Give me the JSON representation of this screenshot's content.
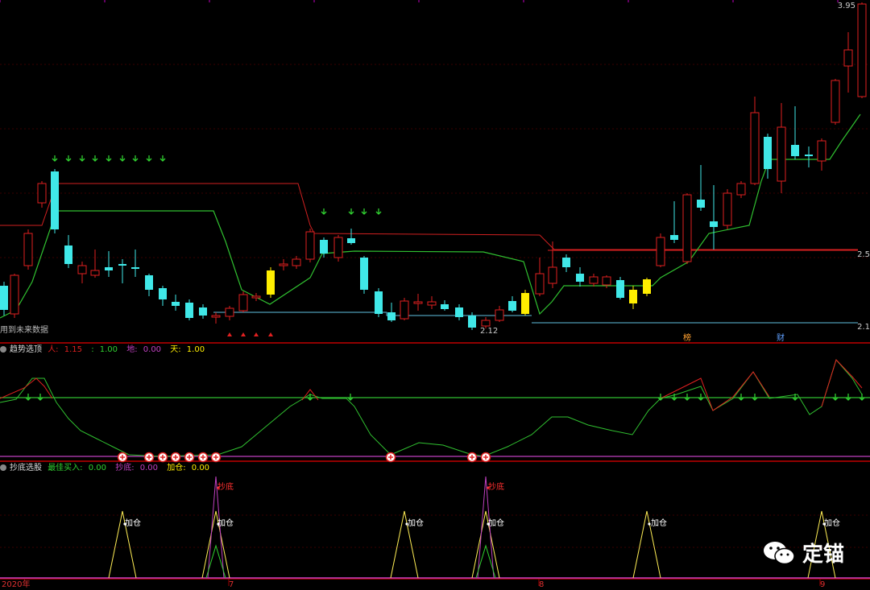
{
  "colors": {
    "bg": "#000000",
    "up": "#e02020",
    "down": "#40e8e8",
    "yellow": "#ffee00",
    "green": "#30d030",
    "panel_border": "#c00000",
    "blue_line": "#60c0e0",
    "magenta": "#c040c0"
  },
  "main_panel": {
    "price_high": "3.95",
    "price_mid": "2.5",
    "price_low": "2.1",
    "low_mark": "2.12",
    "no_data_text": "用到未来数据",
    "tag1": "榜",
    "tag2": "财"
  },
  "panel2": {
    "title": "趋势选顶",
    "items": [
      {
        "label": "人: ",
        "value": "1.15",
        "color": "#e02020"
      },
      {
        "label": ": ",
        "value": "1.00",
        "color": "#30d030"
      },
      {
        "label": "地: ",
        "value": "0.00",
        "color": "#c040c0"
      },
      {
        "label": "天: ",
        "value": "1.00",
        "color": "#ffee00"
      }
    ]
  },
  "panel3": {
    "title": "抄底选股",
    "items": [
      {
        "label": "最佳买入: ",
        "value": "0.00",
        "color": "#30d030"
      },
      {
        "label": "抄底: ",
        "value": "0.00",
        "color": "#c040c0"
      },
      {
        "label": "加仓: ",
        "value": "0.00",
        "color": "#ffee00"
      }
    ],
    "label_add": "加仓",
    "label_bottom": "抄底"
  },
  "x_axis": {
    "year": "2020年",
    "m7": "7",
    "m8": "8",
    "m9": "9"
  },
  "watermark": {
    "text": "定锚"
  }
}
